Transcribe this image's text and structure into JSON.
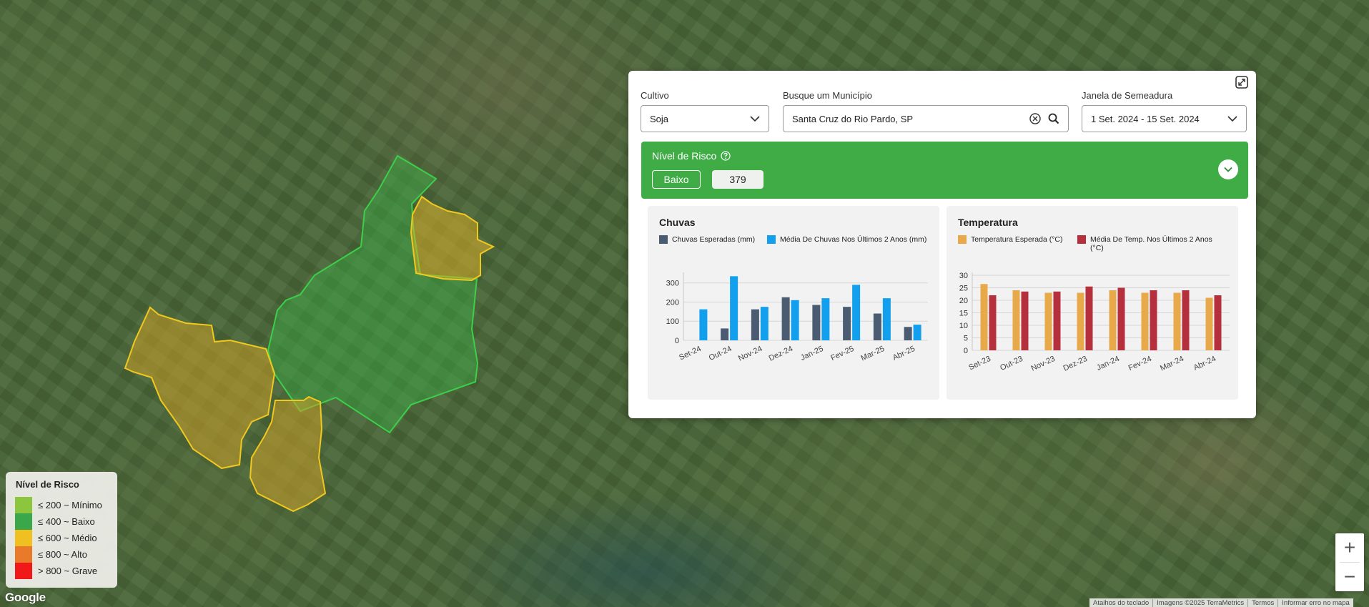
{
  "filters": {
    "crop_label": "Cultivo",
    "crop_value": "Soja",
    "municipality_label": "Busque um Município",
    "municipality_value": "Santa Cruz do Rio Pardo, SP",
    "window_label": "Janela de Semeadura",
    "window_value": "1 Set. 2024 - 15 Set. 2024"
  },
  "risk": {
    "title": "Nível de Risco",
    "level": "Baixo",
    "score": "379",
    "color": "#3fac46"
  },
  "rain_chart": {
    "title": "Chuvas",
    "legend_expected": "Chuvas Esperadas (mm)",
    "legend_average": "Média De Chuvas Nos Últimos 2 Anos (mm)"
  },
  "temp_chart": {
    "title": "Temperatura",
    "legend_expected": "Temperatura Esperada (°C)",
    "legend_average": "Média De Temp. Nos Últimos 2 Anos (°C)"
  },
  "chart_data": [
    {
      "type": "bar",
      "title": "Chuvas",
      "categories": [
        "Set-24",
        "Out-24",
        "Nov-24",
        "Dez-24",
        "Jan-25",
        "Fev-25",
        "Mar-25",
        "Abr-25"
      ],
      "series": [
        {
          "name": "Chuvas Esperadas (mm)",
          "color": "#4a5b72",
          "values": [
            0,
            62,
            162,
            225,
            185,
            175,
            140,
            70
          ]
        },
        {
          "name": "Média De Chuvas Nos Últimos 2 Anos (mm)",
          "color": "#12a0ee",
          "values": [
            162,
            335,
            175,
            210,
            220,
            290,
            220,
            82
          ]
        }
      ],
      "yticks": [
        0,
        100,
        200,
        300
      ],
      "ylim": [
        0,
        340
      ],
      "grid": true
    },
    {
      "type": "bar",
      "title": "Temperatura",
      "categories": [
        "Set-23",
        "Out-23",
        "Nov-23",
        "Dez-23",
        "Jan-24",
        "Fev-24",
        "Mar-24",
        "Abr-24"
      ],
      "series": [
        {
          "name": "Temperatura Esperada (°C)",
          "color": "#e8a94a",
          "values": [
            26.5,
            24,
            23,
            23,
            24,
            23,
            23,
            21
          ]
        },
        {
          "name": "Média De Temp. Nos Últimos 2 Anos (°C)",
          "color": "#b52f3c",
          "values": [
            22,
            23.5,
            23.5,
            25.5,
            25,
            24,
            24,
            22
          ]
        }
      ],
      "yticks": [
        0,
        5,
        10,
        15,
        20,
        25,
        30
      ],
      "ylim": [
        0,
        30
      ],
      "grid": true
    }
  ],
  "map_legend": {
    "title": "Nível de Risco",
    "items": [
      {
        "label": "≤ 200 ~ Mínimo",
        "color": "#8cc63f"
      },
      {
        "label": "≤ 400 ~ Baixo",
        "color": "#3aa84a"
      },
      {
        "label": "≤ 600 ~ Médio",
        "color": "#f0c020"
      },
      {
        "label": "≤ 800 ~ Alto",
        "color": "#e87a2a"
      },
      {
        "label": "> 800 ~ Grave",
        "color": "#f01818"
      }
    ]
  },
  "map": {
    "logo": "Google",
    "zoom_in": "+",
    "zoom_out": "−",
    "attribution": {
      "shortcuts": "Atalhos do teclado",
      "imagery": "Imagens ©2025 TerraMetrics",
      "terms": "Termos",
      "report": "Informar erro no mapa"
    }
  },
  "icons": {
    "expand": "expand-icon",
    "chevron": "chevron-down-icon",
    "clear": "clear-circle-icon",
    "search": "search-icon",
    "help": "help-circle-icon"
  }
}
